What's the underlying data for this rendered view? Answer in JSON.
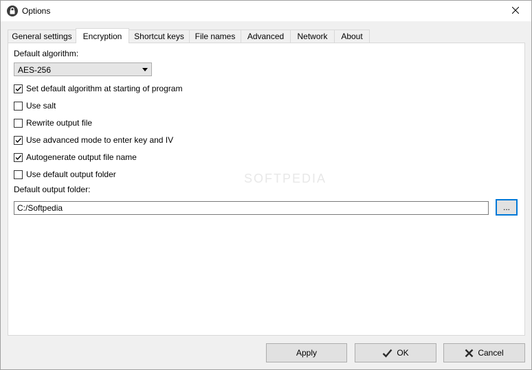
{
  "window": {
    "title": "Options"
  },
  "tabs": [
    {
      "label": "General settings"
    },
    {
      "label": "Encryption"
    },
    {
      "label": "Shortcut keys"
    },
    {
      "label": "File names"
    },
    {
      "label": "Advanced"
    },
    {
      "label": "Network"
    },
    {
      "label": "About"
    }
  ],
  "active_tab": "Encryption",
  "encryption": {
    "default_algorithm_label": "Default algorithm:",
    "algorithm_value": "AES-256",
    "options": [
      {
        "label": "Set default algorithm at starting of program",
        "checked": true
      },
      {
        "label": "Use salt",
        "checked": false
      },
      {
        "label": "Rewrite output file",
        "checked": false
      },
      {
        "label": "Use advanced mode to enter key and IV",
        "checked": true
      },
      {
        "label": "Autogenerate output file name",
        "checked": true
      },
      {
        "label": "Use default output folder",
        "checked": false
      }
    ],
    "output_folder_label": "Default output folder:",
    "output_folder_value": "C:/Softpedia",
    "browse_label": "..."
  },
  "watermark": "SOFTPEDIA",
  "buttons": {
    "apply": "Apply",
    "ok": "OK",
    "cancel": "Cancel"
  }
}
